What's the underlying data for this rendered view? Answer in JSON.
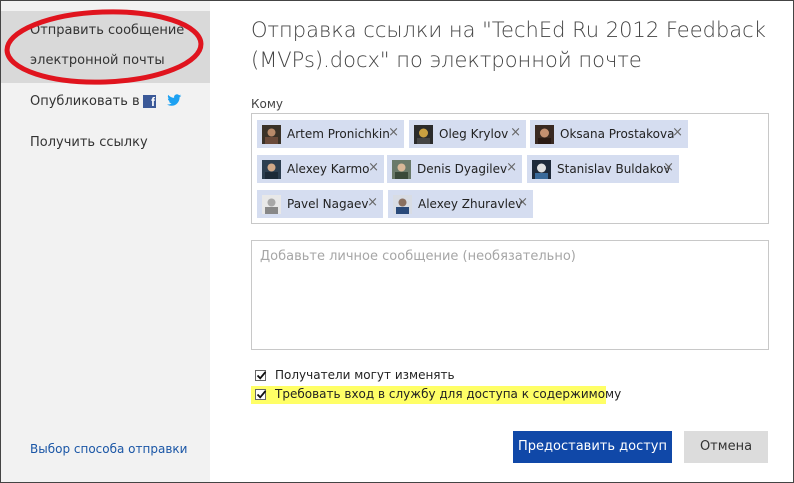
{
  "sidebar": {
    "send_email_line1": "Отправить сообщение",
    "send_email_line2": "электронной почты",
    "publish_label": "Опубликовать в",
    "publish_icons": [
      "facebook-icon",
      "twitter-icon"
    ],
    "get_link_label": "Получить ссылку",
    "footer_link": "Выбор способа отправки"
  },
  "dialog": {
    "title": "Отправка ссылки на \"TechEd Ru 2012 Feedback (MVPs).docx\" по электронной почте",
    "to_label": "Кому",
    "recipients": [
      {
        "name": "Artem Pronichkin",
        "remove": "×"
      },
      {
        "name": "Oleg Krylov",
        "remove": "×"
      },
      {
        "name": "Oksana Prostakova",
        "remove": "×"
      },
      {
        "name": "Alexey Karmo",
        "remove": "×"
      },
      {
        "name": "Denis Dyagilev",
        "remove": "×"
      },
      {
        "name": "Stanislav Buldakov",
        "remove": "×"
      },
      {
        "name": "Pavel Nagaev",
        "remove": "×"
      },
      {
        "name": "Alexey Zhuravlev",
        "remove": "×"
      }
    ],
    "message_placeholder": "Добавьте личное сообщение (необязательно)",
    "options": [
      {
        "label": "Получатели могут изменять",
        "checked": true
      },
      {
        "label": "Требовать вход в службу для доступа к содержимому",
        "checked": true
      }
    ],
    "share_button": "Предоставить доступ",
    "cancel_button": "Отмена"
  },
  "colors": {
    "primary": "#1048a8",
    "chip": "#d5ddf0",
    "highlight": "#ffff66",
    "annotation": "#e0141e",
    "link": "#1a56a6"
  }
}
